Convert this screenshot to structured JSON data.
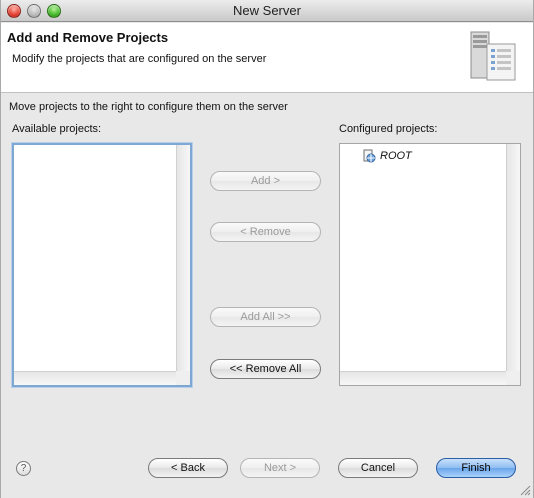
{
  "window": {
    "title": "New Server"
  },
  "banner": {
    "heading": "Add and Remove Projects",
    "description": "Modify the projects that are configured on the server",
    "icon": "server-icon"
  },
  "instruction": "Move projects to the right to configure them on the server",
  "available": {
    "label": "Available projects:",
    "items": []
  },
  "configured": {
    "label": "Configured projects:",
    "items": [
      {
        "label": "ROOT",
        "icon": "web-project-icon"
      }
    ]
  },
  "transfer_buttons": {
    "add": "Add >",
    "remove": "< Remove",
    "add_all": "Add All >>",
    "remove_all": "<< Remove All"
  },
  "footer": {
    "help": "?",
    "back": "< Back",
    "next": "Next >",
    "cancel": "Cancel",
    "finish": "Finish"
  },
  "colors": {
    "default_button": "#6aa5ea",
    "focus_border": "#7fa7d4"
  }
}
